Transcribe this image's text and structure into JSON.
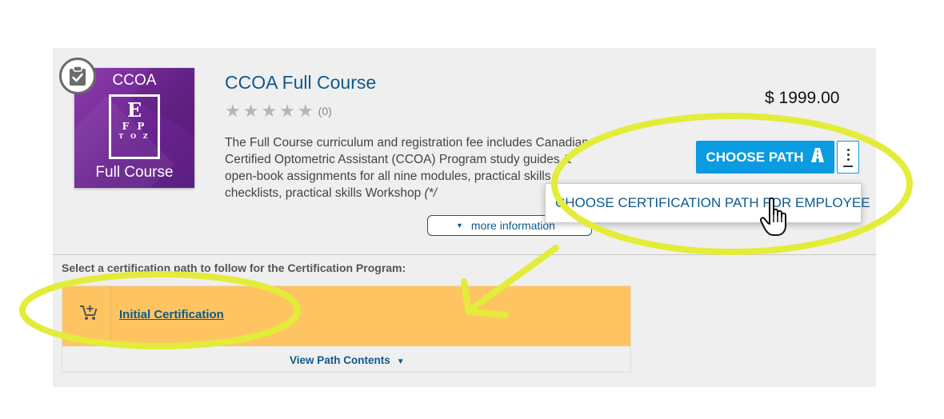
{
  "course": {
    "title": "CCOA Full Course",
    "rating_count": "(0)",
    "description": "The Full Course curriculum and registration fee includes Canadian Certified Optometric Assistant (CCOA) Program study guides & open-book assignments for all nine modules, practical skills checklists, practical skills Workshop",
    "description_note": "(*/",
    "price": "$ 1999.00",
    "more_info_label": "more information"
  },
  "thumbnail": {
    "top_text": "CCOA",
    "bottom_text": "Full Course",
    "chart_line1": "E",
    "chart_line2": "F P",
    "chart_line3": "T O Z"
  },
  "actions": {
    "choose_path_label": "CHOOSE PATH",
    "dropdown_item": "CHOOSE CERTIFICATION PATH FOR EMPLOYEE"
  },
  "paths": {
    "prompt": "Select a certification path to follow for the Certification Program:",
    "items": [
      {
        "label": "Initial Certification"
      }
    ],
    "view_contents_label": "View Path Contents"
  },
  "colors": {
    "accent_blue": "#0a9be0",
    "link_blue": "#0e5a8a",
    "path_row": "#fec462",
    "annotation": "#e3ec3a",
    "thumbnail": "#7a2fa0"
  },
  "icons": [
    "checklist-icon",
    "star-icon",
    "road-icon",
    "kebab-menu-icon",
    "cart-add-icon",
    "caret-down-icon",
    "hand-cursor-icon"
  ]
}
